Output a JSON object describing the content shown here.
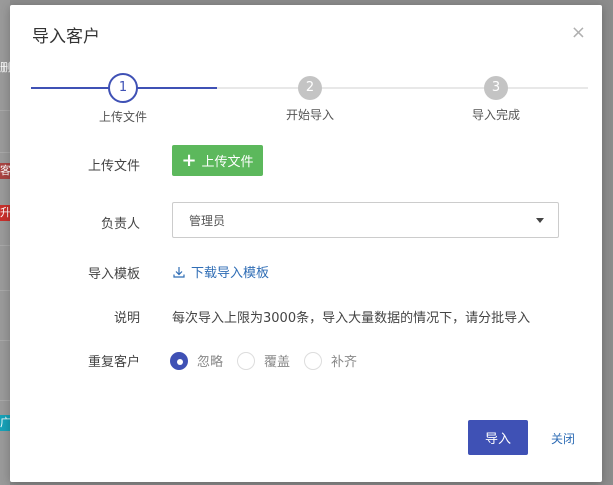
{
  "background": {
    "tags": [
      {
        "text": "删",
        "color": "#8c8c8c"
      },
      {
        "text": "客",
        "color": "#a94442"
      },
      {
        "text": "升",
        "color": "#c9302c"
      },
      {
        "text": "广",
        "color": "#17a2b8"
      }
    ]
  },
  "modal": {
    "title": "导入客户",
    "close_icon": "×"
  },
  "stepper": {
    "steps": [
      {
        "number": "1",
        "label": "上传文件",
        "state": "active"
      },
      {
        "number": "2",
        "label": "开始导入",
        "state": "pending"
      },
      {
        "number": "3",
        "label": "导入完成",
        "state": "pending"
      }
    ],
    "progress_percent": 33
  },
  "form": {
    "upload": {
      "label": "上传文件",
      "button": "上传文件",
      "icon": "plus-icon"
    },
    "owner": {
      "label": "负责人",
      "value": "管理员",
      "icon": "caret-down-icon"
    },
    "template": {
      "label": "导入模板",
      "link": "下载导入模板",
      "icon": "download-icon"
    },
    "note": {
      "label": "说明",
      "text": "每次导入上限为3000条，导入大量数据的情况下，请分批导入"
    },
    "duplicate": {
      "label": "重复客户",
      "options": [
        {
          "label": "忽略",
          "checked": true
        },
        {
          "label": "覆盖",
          "checked": false
        },
        {
          "label": "补齐",
          "checked": false
        }
      ]
    }
  },
  "footer": {
    "import_label": "导入",
    "close_label": "关闭"
  },
  "colors": {
    "primary": "#3f51b5",
    "success": "#5cb85c",
    "link": "#2f6db5"
  }
}
